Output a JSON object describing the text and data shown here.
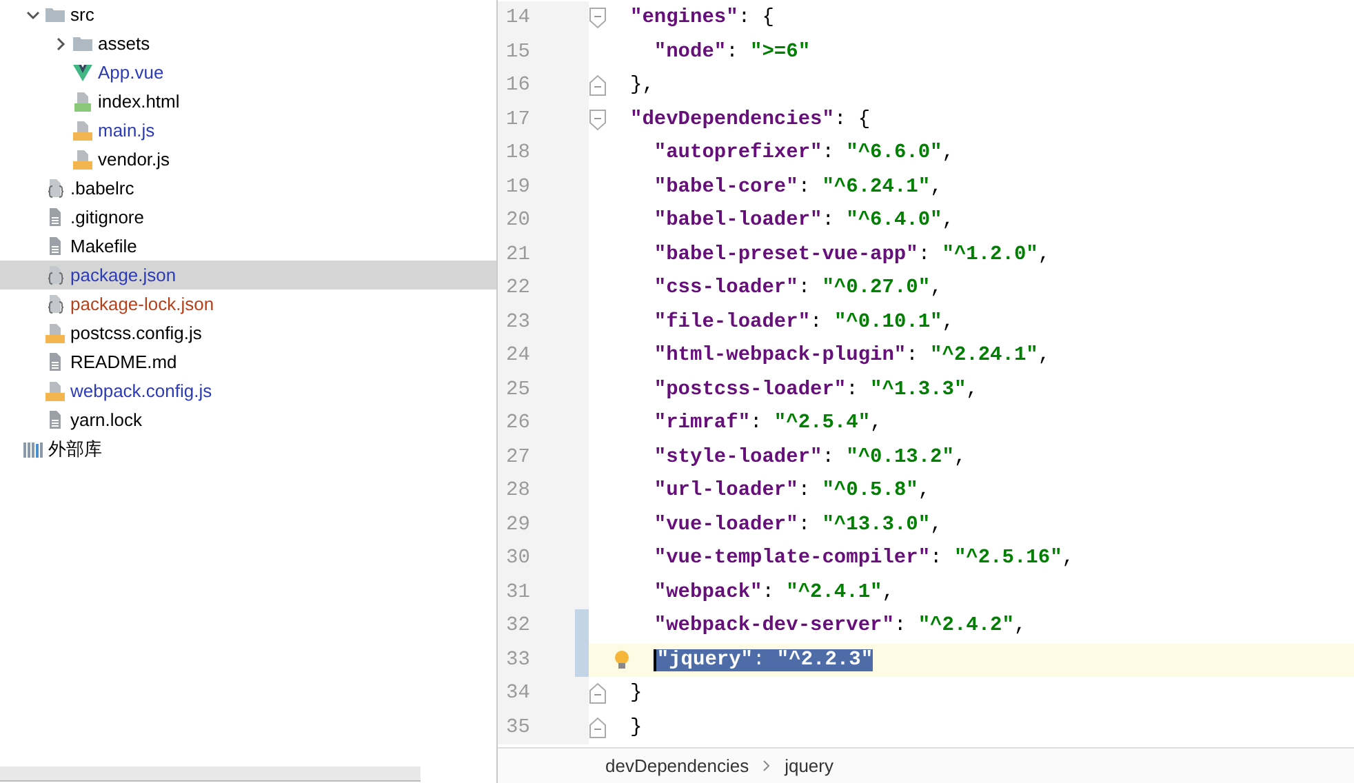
{
  "project_tree": {
    "items": [
      {
        "kind": "group",
        "children": [
          {
            "label": "src",
            "kind": "folder",
            "expanded": true,
            "selected": false,
            "color": "#000000",
            "children": [
              {
                "label": "assets",
                "kind": "folder",
                "expanded": false,
                "selected": false,
                "color": "#000000"
              },
              {
                "label": "App.vue",
                "kind": "vue",
                "selected": false,
                "color": "#2b3bb8"
              },
              {
                "label": "index.html",
                "kind": "html",
                "selected": false,
                "color": "#000000"
              },
              {
                "label": "main.js",
                "kind": "js",
                "selected": false,
                "color": "#2b3bb8"
              },
              {
                "label": "vendor.js",
                "kind": "js",
                "selected": false,
                "color": "#000000"
              }
            ]
          },
          {
            "label": ".babelrc",
            "kind": "json",
            "selected": false,
            "color": "#000000"
          },
          {
            "label": ".gitignore",
            "kind": "text",
            "selected": false,
            "color": "#000000"
          },
          {
            "label": "Makefile",
            "kind": "text",
            "selected": false,
            "color": "#000000"
          },
          {
            "label": "package.json",
            "kind": "json",
            "selected": true,
            "color": "#2b3bb8"
          },
          {
            "label": "package-lock.json",
            "kind": "json",
            "selected": false,
            "color": "#b5401c"
          },
          {
            "label": "postcss.config.js",
            "kind": "js",
            "selected": false,
            "color": "#000000"
          },
          {
            "label": "README.md",
            "kind": "text",
            "selected": false,
            "color": "#000000"
          },
          {
            "label": "webpack.config.js",
            "kind": "js",
            "selected": false,
            "color": "#2b3bb8"
          },
          {
            "label": "yarn.lock",
            "kind": "text",
            "selected": false,
            "color": "#000000"
          }
        ]
      },
      {
        "label": "外部库",
        "kind": "library",
        "selected": false,
        "color": "#000000"
      }
    ]
  },
  "editor": {
    "lines": [
      {
        "number": "14",
        "fold_start": true,
        "fold_end": false,
        "changed": false,
        "current": false,
        "selected": false,
        "bulb": false,
        "tokens": [
          {
            "kind": "key",
            "text": "\"engines\""
          },
          {
            "kind": "punct",
            "text": ": {"
          }
        ]
      },
      {
        "number": "15",
        "fold_start": false,
        "fold_end": false,
        "changed": false,
        "current": false,
        "selected": false,
        "bulb": false,
        "tokens": [
          {
            "kind": "key",
            "text": "  \"node\""
          },
          {
            "kind": "punct",
            "text": ": "
          },
          {
            "kind": "value",
            "text": "\">=6\""
          }
        ]
      },
      {
        "number": "16",
        "fold_start": false,
        "fold_end": true,
        "changed": false,
        "current": false,
        "selected": false,
        "bulb": false,
        "tokens": [
          {
            "kind": "punct",
            "text": "},"
          }
        ]
      },
      {
        "number": "17",
        "fold_start": true,
        "fold_end": false,
        "changed": false,
        "current": false,
        "selected": false,
        "bulb": false,
        "tokens": [
          {
            "kind": "key",
            "text": "\"devDependencies\""
          },
          {
            "kind": "punct",
            "text": ": {"
          }
        ]
      },
      {
        "number": "18",
        "fold_start": false,
        "fold_end": false,
        "changed": false,
        "current": false,
        "selected": false,
        "bulb": false,
        "tokens": [
          {
            "kind": "key",
            "text": "  \"autoprefixer\""
          },
          {
            "kind": "punct",
            "text": ": "
          },
          {
            "kind": "value",
            "text": "\"^6.6.0\""
          },
          {
            "kind": "punct",
            "text": ","
          }
        ]
      },
      {
        "number": "19",
        "fold_start": false,
        "fold_end": false,
        "changed": false,
        "current": false,
        "selected": false,
        "bulb": false,
        "tokens": [
          {
            "kind": "key",
            "text": "  \"babel-core\""
          },
          {
            "kind": "punct",
            "text": ": "
          },
          {
            "kind": "value",
            "text": "\"^6.24.1\""
          },
          {
            "kind": "punct",
            "text": ","
          }
        ]
      },
      {
        "number": "20",
        "fold_start": false,
        "fold_end": false,
        "changed": false,
        "current": false,
        "selected": false,
        "bulb": false,
        "tokens": [
          {
            "kind": "key",
            "text": "  \"babel-loader\""
          },
          {
            "kind": "punct",
            "text": ": "
          },
          {
            "kind": "value",
            "text": "\"^6.4.0\""
          },
          {
            "kind": "punct",
            "text": ","
          }
        ]
      },
      {
        "number": "21",
        "fold_start": false,
        "fold_end": false,
        "changed": false,
        "current": false,
        "selected": false,
        "bulb": false,
        "tokens": [
          {
            "kind": "key",
            "text": "  \"babel-preset-vue-app\""
          },
          {
            "kind": "punct",
            "text": ": "
          },
          {
            "kind": "value",
            "text": "\"^1.2.0\""
          },
          {
            "kind": "punct",
            "text": ","
          }
        ]
      },
      {
        "number": "22",
        "fold_start": false,
        "fold_end": false,
        "changed": false,
        "current": false,
        "selected": false,
        "bulb": false,
        "tokens": [
          {
            "kind": "key",
            "text": "  \"css-loader\""
          },
          {
            "kind": "punct",
            "text": ": "
          },
          {
            "kind": "value",
            "text": "\"^0.27.0\""
          },
          {
            "kind": "punct",
            "text": ","
          }
        ]
      },
      {
        "number": "23",
        "fold_start": false,
        "fold_end": false,
        "changed": false,
        "current": false,
        "selected": false,
        "bulb": false,
        "tokens": [
          {
            "kind": "key",
            "text": "  \"file-loader\""
          },
          {
            "kind": "punct",
            "text": ": "
          },
          {
            "kind": "value",
            "text": "\"^0.10.1\""
          },
          {
            "kind": "punct",
            "text": ","
          }
        ]
      },
      {
        "number": "24",
        "fold_start": false,
        "fold_end": false,
        "changed": false,
        "current": false,
        "selected": false,
        "bulb": false,
        "tokens": [
          {
            "kind": "key",
            "text": "  \"html-webpack-plugin\""
          },
          {
            "kind": "punct",
            "text": ": "
          },
          {
            "kind": "value",
            "text": "\"^2.24.1\""
          },
          {
            "kind": "punct",
            "text": ","
          }
        ]
      },
      {
        "number": "25",
        "fold_start": false,
        "fold_end": false,
        "changed": false,
        "current": false,
        "selected": false,
        "bulb": false,
        "tokens": [
          {
            "kind": "key",
            "text": "  \"postcss-loader\""
          },
          {
            "kind": "punct",
            "text": ": "
          },
          {
            "kind": "value",
            "text": "\"^1.3.3\""
          },
          {
            "kind": "punct",
            "text": ","
          }
        ]
      },
      {
        "number": "26",
        "fold_start": false,
        "fold_end": false,
        "changed": false,
        "current": false,
        "selected": false,
        "bulb": false,
        "tokens": [
          {
            "kind": "key",
            "text": "  \"rimraf\""
          },
          {
            "kind": "punct",
            "text": ": "
          },
          {
            "kind": "value",
            "text": "\"^2.5.4\""
          },
          {
            "kind": "punct",
            "text": ","
          }
        ]
      },
      {
        "number": "27",
        "fold_start": false,
        "fold_end": false,
        "changed": false,
        "current": false,
        "selected": false,
        "bulb": false,
        "tokens": [
          {
            "kind": "key",
            "text": "  \"style-loader\""
          },
          {
            "kind": "punct",
            "text": ": "
          },
          {
            "kind": "value",
            "text": "\"^0.13.2\""
          },
          {
            "kind": "punct",
            "text": ","
          }
        ]
      },
      {
        "number": "28",
        "fold_start": false,
        "fold_end": false,
        "changed": false,
        "current": false,
        "selected": false,
        "bulb": false,
        "tokens": [
          {
            "kind": "key",
            "text": "  \"url-loader\""
          },
          {
            "kind": "punct",
            "text": ": "
          },
          {
            "kind": "value",
            "text": "\"^0.5.8\""
          },
          {
            "kind": "punct",
            "text": ","
          }
        ]
      },
      {
        "number": "29",
        "fold_start": false,
        "fold_end": false,
        "changed": false,
        "current": false,
        "selected": false,
        "bulb": false,
        "tokens": [
          {
            "kind": "key",
            "text": "  \"vue-loader\""
          },
          {
            "kind": "punct",
            "text": ": "
          },
          {
            "kind": "value",
            "text": "\"^13.3.0\""
          },
          {
            "kind": "punct",
            "text": ","
          }
        ]
      },
      {
        "number": "30",
        "fold_start": false,
        "fold_end": false,
        "changed": false,
        "current": false,
        "selected": false,
        "bulb": false,
        "tokens": [
          {
            "kind": "key",
            "text": "  \"vue-template-compiler\""
          },
          {
            "kind": "punct",
            "text": ": "
          },
          {
            "kind": "value",
            "text": "\"^2.5.16\""
          },
          {
            "kind": "punct",
            "text": ","
          }
        ]
      },
      {
        "number": "31",
        "fold_start": false,
        "fold_end": false,
        "changed": false,
        "current": false,
        "selected": false,
        "bulb": false,
        "tokens": [
          {
            "kind": "key",
            "text": "  \"webpack\""
          },
          {
            "kind": "punct",
            "text": ": "
          },
          {
            "kind": "value",
            "text": "\"^2.4.1\""
          },
          {
            "kind": "punct",
            "text": ","
          }
        ]
      },
      {
        "number": "32",
        "fold_start": false,
        "fold_end": false,
        "changed": true,
        "current": false,
        "selected": false,
        "bulb": false,
        "tokens": [
          {
            "kind": "key",
            "text": "  \"webpack-dev-server\""
          },
          {
            "kind": "punct",
            "text": ": "
          },
          {
            "kind": "value",
            "text": "\"^2.4.2\""
          },
          {
            "kind": "punct",
            "text": ","
          }
        ]
      },
      {
        "number": "33",
        "fold_start": false,
        "fold_end": false,
        "changed": true,
        "current": true,
        "selected": true,
        "bulb": true,
        "tokens": [
          {
            "kind": "key",
            "text": "\"jquery\""
          },
          {
            "kind": "punct",
            "text": ": "
          },
          {
            "kind": "value",
            "text": "\"^2.2.3\""
          }
        ]
      },
      {
        "number": "34",
        "fold_start": false,
        "fold_end": true,
        "changed": false,
        "current": false,
        "selected": false,
        "bulb": false,
        "tokens": [
          {
            "kind": "punct",
            "text": "}"
          }
        ]
      },
      {
        "number": "35",
        "fold_start": false,
        "fold_end": true,
        "changed": false,
        "current": false,
        "selected": false,
        "bulb": false,
        "tokens": [
          {
            "kind": "punct",
            "text": "}"
          }
        ]
      }
    ]
  },
  "breadcrumbs": [
    "devDependencies",
    "jquery"
  ]
}
